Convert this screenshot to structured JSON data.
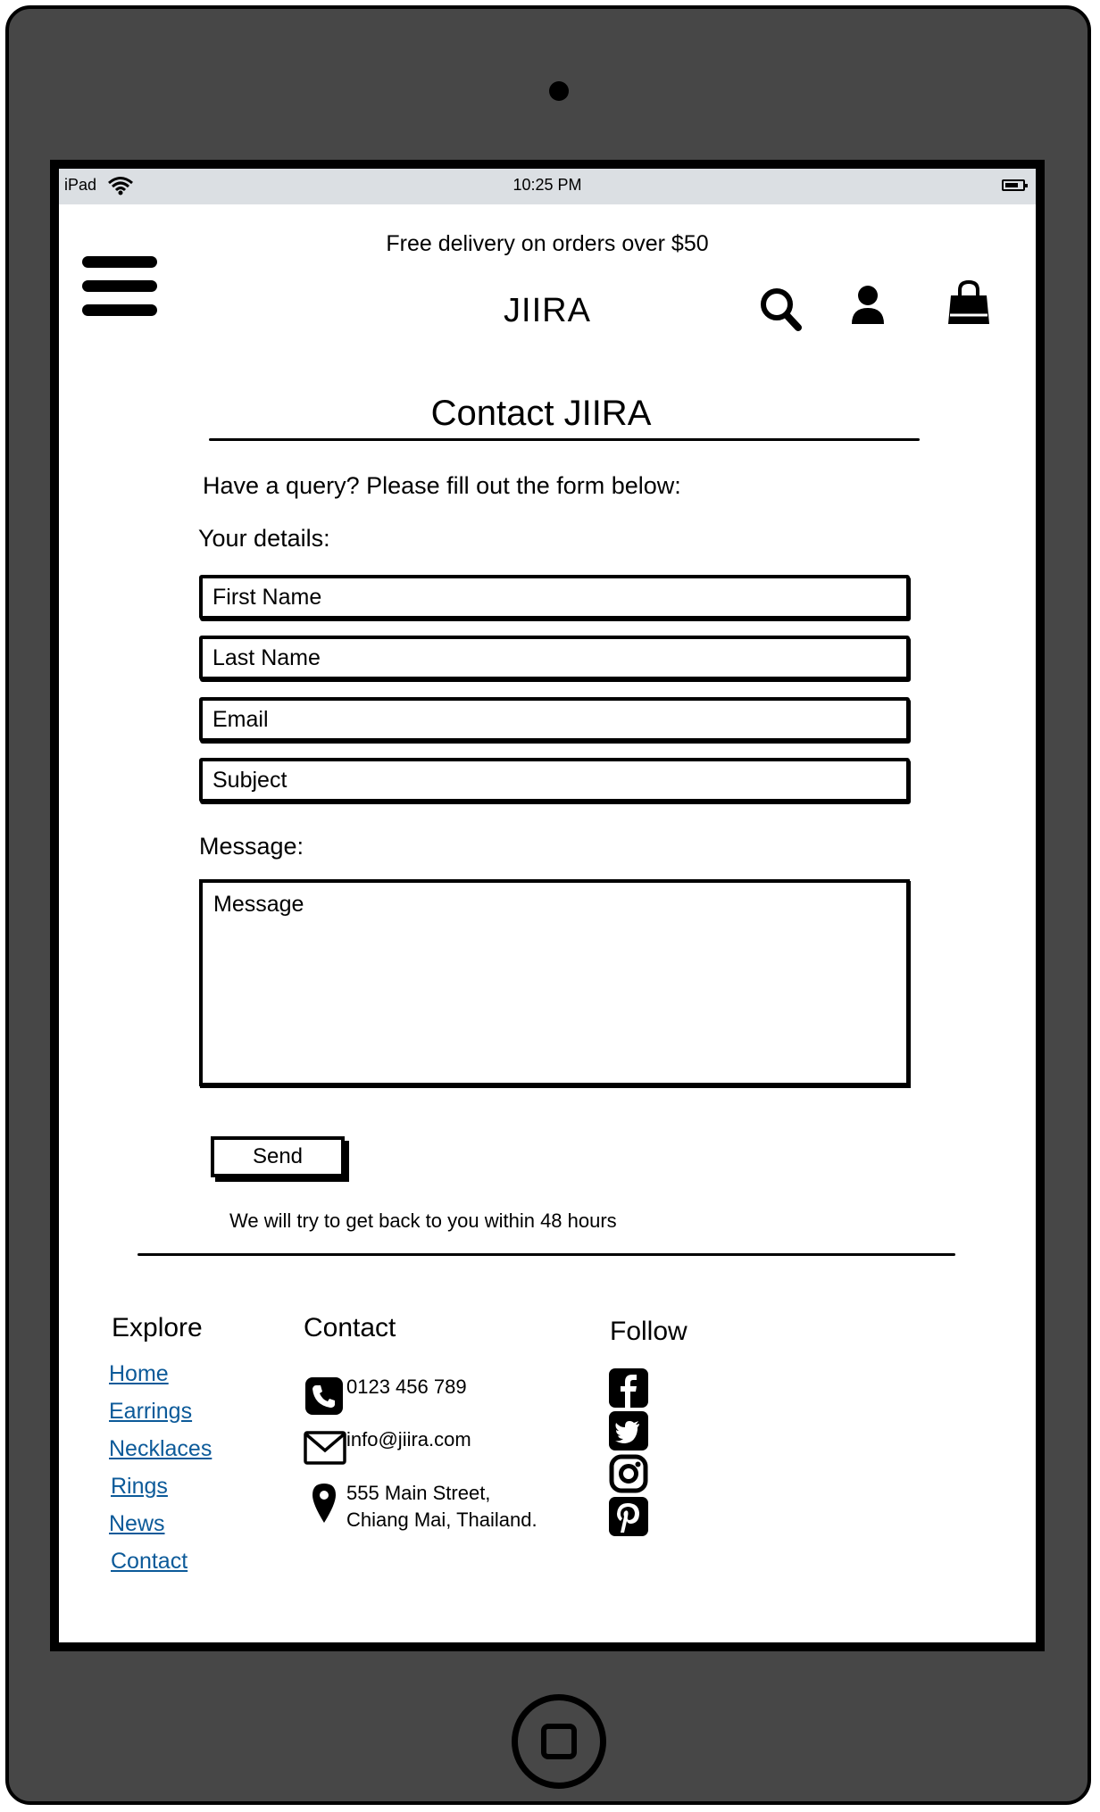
{
  "statusbar": {
    "device": "iPad",
    "time": "10:25 PM"
  },
  "promo": "Free delivery on orders over $50",
  "header": {
    "logo": "JIIRA",
    "icons": [
      "menu-icon",
      "search-icon",
      "user-icon",
      "shopping-bag-icon"
    ]
  },
  "contact_form": {
    "title": "Contact JIIRA",
    "intro": "Have a query? Please fill out the form below:",
    "details_label": "Your details:",
    "first_name_placeholder": "First Name",
    "last_name_placeholder": "Last Name",
    "email_placeholder": "Email",
    "subject_placeholder": "Subject",
    "message_label": "Message:",
    "message_placeholder": "Message",
    "send_label": "Send",
    "reply_note": "We will try to get back to you within 48 hours"
  },
  "footer": {
    "explore": {
      "title": "Explore",
      "links": [
        "Home",
        "Earrings",
        "Necklaces",
        "Rings",
        "News",
        "Contact"
      ]
    },
    "contact": {
      "title": "Contact",
      "phone": "0123 456 789",
      "email": "info@jiira.com",
      "address_line1": "555 Main Street,",
      "address_line2": "Chiang Mai, Thailand."
    },
    "follow": {
      "title": "Follow",
      "icons": [
        "facebook-icon",
        "twitter-icon",
        "instagram-icon",
        "pinterest-icon"
      ]
    }
  },
  "colors": {
    "link": "#0c5a99",
    "device_frame": "#474747",
    "statusbar": "#dbdfe3"
  }
}
